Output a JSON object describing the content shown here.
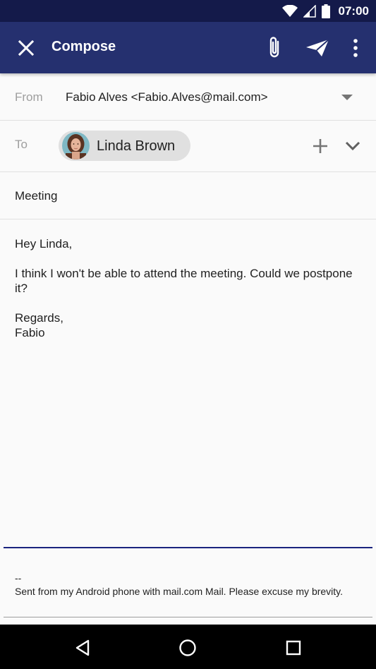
{
  "status_bar": {
    "time": "07:00",
    "icons": [
      "wifi-icon",
      "cell-signal-icon",
      "battery-icon"
    ]
  },
  "toolbar": {
    "title": "Compose",
    "icons": [
      "close-icon",
      "attachment-icon",
      "send-icon",
      "more-vert-icon"
    ]
  },
  "from": {
    "label": "From",
    "value": "Fabio Alves <Fabio.Alves@mail.com>"
  },
  "to": {
    "label": "To",
    "recipient_name": "Linda Brown"
  },
  "subject": "Meeting",
  "body": {
    "greeting": "Hey Linda,",
    "message": "I think I won't be able to attend the meeting. Could we postpone it?",
    "closing": "Regards,",
    "sender": "Fabio"
  },
  "signature": {
    "separator": "--",
    "text": "Sent from my Android phone with mail.com Mail. Please excuse my brevity."
  },
  "colors": {
    "toolbar": "#25306f",
    "status_bar": "#141a4a",
    "accent": "#1a237e"
  }
}
